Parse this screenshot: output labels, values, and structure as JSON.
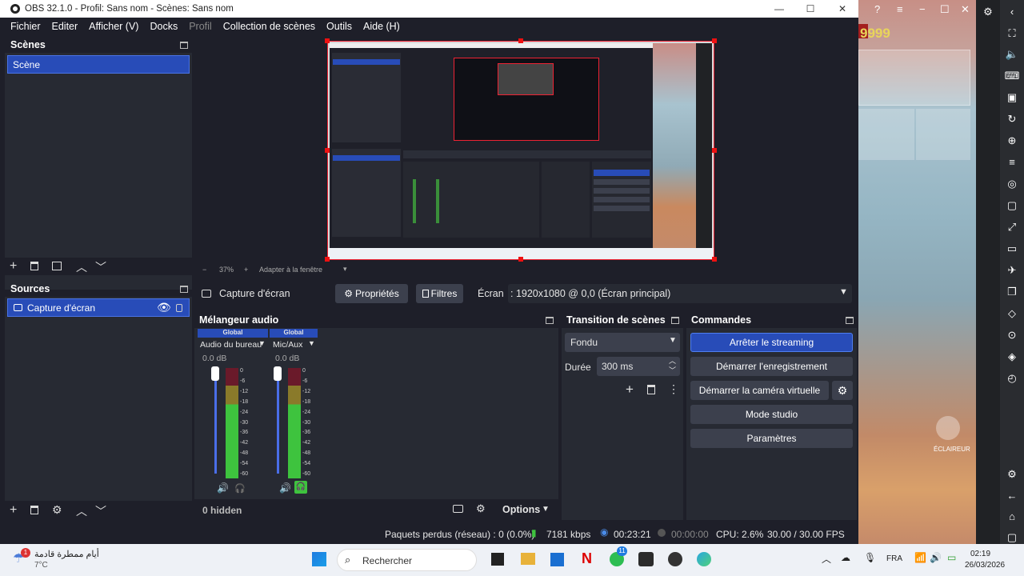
{
  "window": {
    "title": "OBS 32.1.0 - Profil: Sans nom - Scènes: Sans nom",
    "minimize": "—",
    "maximize": "☐",
    "close": "✕"
  },
  "menu": [
    "Fichier",
    "Editer",
    "Afficher (V)",
    "Docks",
    "Profil",
    "Collection de scènes",
    "Outils",
    "Aide (H)"
  ],
  "scenes": {
    "title": "Scènes",
    "items": [
      "Scène"
    ]
  },
  "sources": {
    "title": "Sources",
    "items": [
      "Capture d'écran"
    ]
  },
  "preview": {
    "zoom": "37%",
    "fit_label": "Adapter à la fenêtre"
  },
  "source_toolbar": {
    "source_name": "Capture d'écran",
    "properties": "Propriétés",
    "filters": "Filtres",
    "screen_label": "Écran",
    "screen_value": ": 1920x1080 @ 0,0 (Écran principal)"
  },
  "mixer": {
    "title": "Mélangeur audio",
    "channels": [
      {
        "badge": "Global",
        "name": "Audio du bureau",
        "level": "0.0 dB"
      },
      {
        "badge": "Global",
        "name": "Mic/Aux",
        "level": "0.0 dB"
      }
    ],
    "scale": [
      "0",
      "-6",
      "-12",
      "-18",
      "-24",
      "-30",
      "-36",
      "-42",
      "-48",
      "-54",
      "-60"
    ],
    "hidden": "0 hidden",
    "options": "Options"
  },
  "transitions": {
    "title": "Transition de scènes",
    "type": "Fondu",
    "duration_label": "Durée",
    "duration_value": "300 ms"
  },
  "controls": {
    "title": "Commandes",
    "stop_stream": "Arrêter le streaming",
    "start_record": "Démarrer l'enregistrement",
    "virtual_cam": "Démarrer la caméra virtuelle",
    "studio_mode": "Mode studio",
    "settings": "Paramètres"
  },
  "status": {
    "dropped": "Paquets perdus (réseau) : 0 (0.0%)",
    "bitrate": "7181 kbps",
    "stream_time": "00:23:21",
    "record_time": "00:00:00",
    "cpu": "CPU: 2.6%",
    "fps": "30.00 / 30.00 FPS"
  },
  "game": {
    "score": "9999",
    "label": "ÉCLAIREUR"
  },
  "taskbar": {
    "weather_text": "أيام ممطرة قادمة",
    "temp": "7°C",
    "weather_badge": "1",
    "search": "Rechercher",
    "whatsapp_badge": "11",
    "lang": "FRA",
    "time": "02:19",
    "date": "26/03/2026"
  },
  "colors": {
    "accent": "#284cb8",
    "panel": "#272a33",
    "bg": "#1e1f29",
    "live_green": "#3ec33e"
  }
}
